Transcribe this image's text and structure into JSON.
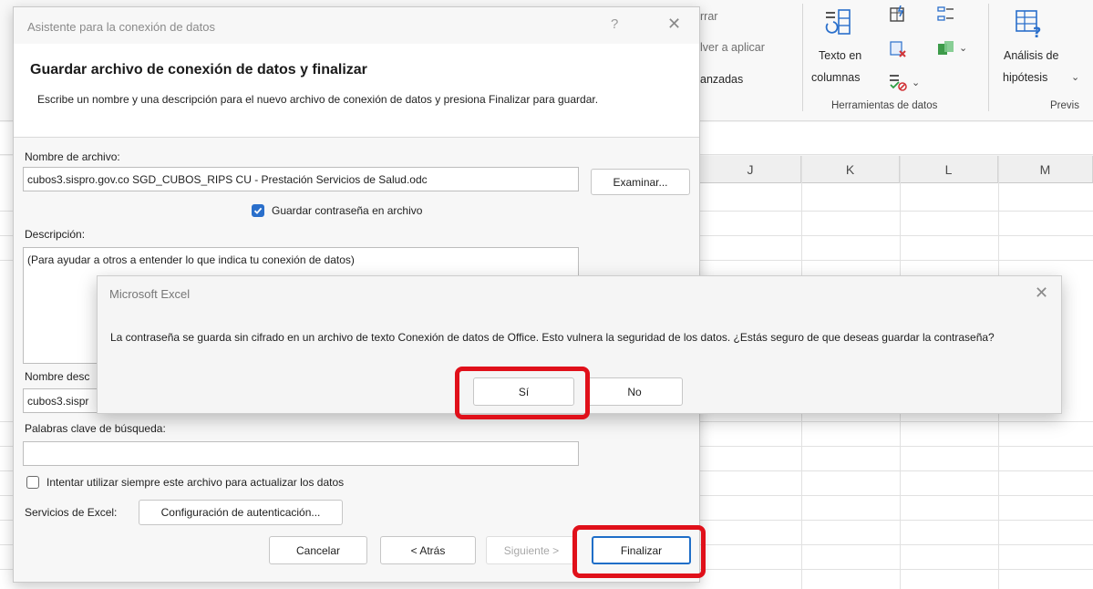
{
  "ribbon": {
    "partial_text_1": "rrar",
    "partial_text_2": "lver a aplicar",
    "partial_text_3": "anzadas",
    "texto_en_columnas_line1": "Texto en",
    "texto_en_columnas_line2": "columnas",
    "analisis_line1": "Análisis de",
    "analisis_line2": "hipótesis",
    "group_herramientas": "Herramientas de datos",
    "group_previs": "Previs",
    "chevron": "⌄"
  },
  "grid": {
    "columns": [
      "J",
      "K",
      "L",
      "M"
    ]
  },
  "wizard": {
    "title": "Asistente para la conexión de datos",
    "help_glyph": "?",
    "close_glyph": "✕",
    "heading": "Guardar archivo de conexión de datos y finalizar",
    "subtitle": "Escribe un nombre y una descripción para el nuevo archivo de conexión de datos y presiona Finalizar para guardar.",
    "file_name_label": "Nombre de archivo:",
    "file_name_value": "cubos3.sispro.gov.co SGD_CUBOS_RIPS CU - Prestación Servicios de Salud.odc",
    "browse_button": "Examinar...",
    "save_password_label": "Guardar contraseña en archivo",
    "description_label": "Descripción:",
    "description_value": "(Para ayudar a otros a entender lo que indica tu conexión de datos)",
    "friendly_name_label": "Nombre desc",
    "friendly_name_value": "cubos3.sispr",
    "keywords_label": "Palabras clave de búsqueda:",
    "keywords_value": "",
    "always_use_label": "Intentar utilizar siempre este archivo para actualizar los datos",
    "excel_services_label": "Servicios de Excel:",
    "auth_config_button": "Configuración de autenticación...",
    "cancel_button": "Cancelar",
    "back_button": "< Atrás",
    "next_button": "Siguiente >",
    "finish_button": "Finalizar"
  },
  "msgbox": {
    "title": "Microsoft Excel",
    "close_glyph": "✕",
    "message": "La contraseña se guarda sin cifrado en un archivo de texto Conexión de datos de Office. Esto vulnera la seguridad de los datos. ¿Estás seguro de que deseas guardar la contraseña?",
    "yes_button": "Sí",
    "no_button": "No"
  },
  "colors": {
    "highlight": "#e0101a",
    "accent": "#2a6fcb"
  }
}
